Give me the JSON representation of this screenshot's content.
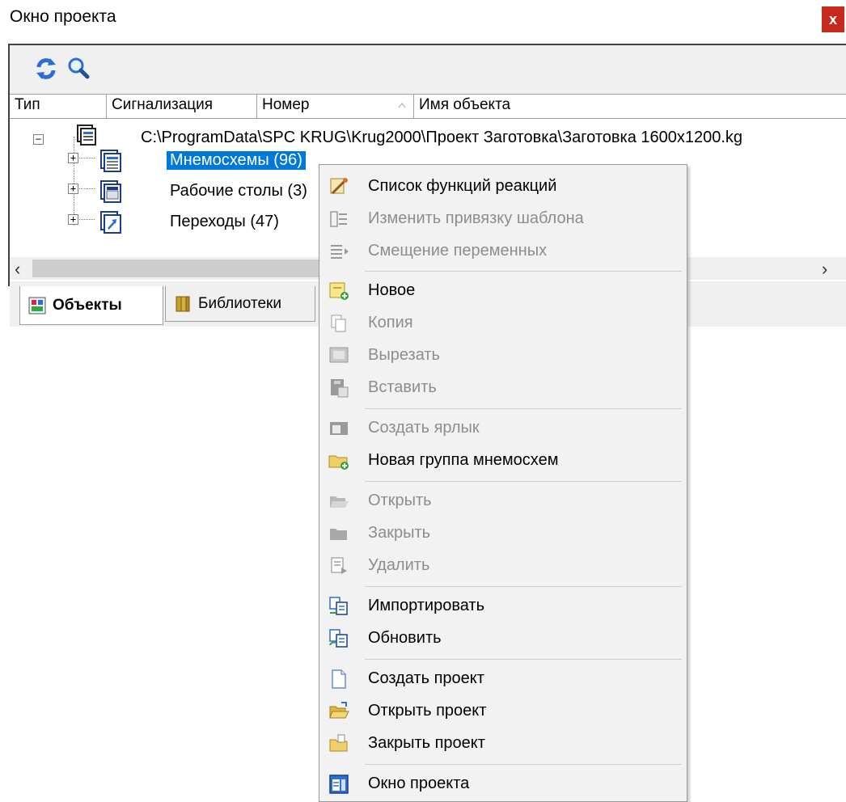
{
  "window": {
    "title": "Окно проекта",
    "close_label": "x"
  },
  "columns": [
    {
      "label": "Тип"
    },
    {
      "label": "Сигнализация"
    },
    {
      "label": "Номер"
    },
    {
      "label": "Имя объекта"
    }
  ],
  "tree": {
    "root": {
      "label": "C:\\ProgramData\\SPC KRUG\\Krug2000\\Проект Заготовка\\Заготовка 1600x1200.kg",
      "expander": "−"
    },
    "children": [
      {
        "label": "Мнемосхемы (96)",
        "expander": "+",
        "selected": true
      },
      {
        "label": "Рабочие столы (3)",
        "expander": "+"
      },
      {
        "label": "Переходы (47)",
        "expander": "+"
      }
    ]
  },
  "scrollbar": {
    "left_arrow": "‹",
    "right_arrow": "›"
  },
  "tabs": [
    {
      "label": "Объекты",
      "active": true
    },
    {
      "label": "Библиотеки",
      "active": false
    }
  ],
  "context_menu": {
    "items": [
      {
        "label": "Список функций реакций",
        "enabled": true,
        "icon": "reaction-list-icon"
      },
      {
        "label": "Изменить привязку шаблона",
        "enabled": false,
        "icon": "template-binding-icon"
      },
      {
        "label": "Смещение переменных",
        "enabled": false,
        "icon": "variable-offset-icon"
      },
      {
        "label": "Новое",
        "enabled": true,
        "icon": "new-icon"
      },
      {
        "label": "Копия",
        "enabled": false,
        "icon": "copy-icon"
      },
      {
        "label": "Вырезать",
        "enabled": false,
        "icon": "cut-icon"
      },
      {
        "label": "Вставить",
        "enabled": false,
        "icon": "paste-icon"
      },
      {
        "label": "Создать ярлык",
        "enabled": false,
        "icon": "shortcut-icon"
      },
      {
        "label": "Новая группа мнемосхем",
        "enabled": true,
        "icon": "new-folder-icon"
      },
      {
        "label": "Открыть",
        "enabled": false,
        "icon": "open-icon"
      },
      {
        "label": "Закрыть",
        "enabled": false,
        "icon": "close-folder-icon"
      },
      {
        "label": "Удалить",
        "enabled": false,
        "icon": "delete-icon"
      },
      {
        "label": "Импортировать",
        "enabled": true,
        "icon": "import-icon"
      },
      {
        "label": "Обновить",
        "enabled": true,
        "icon": "update-icon"
      },
      {
        "label": "Создать проект",
        "enabled": true,
        "icon": "new-project-icon"
      },
      {
        "label": "Открыть проект",
        "enabled": true,
        "icon": "open-project-icon"
      },
      {
        "label": "Закрыть проект",
        "enabled": true,
        "icon": "close-project-icon"
      },
      {
        "label": "Окно проекта",
        "enabled": true,
        "icon": "project-window-icon"
      }
    ]
  }
}
